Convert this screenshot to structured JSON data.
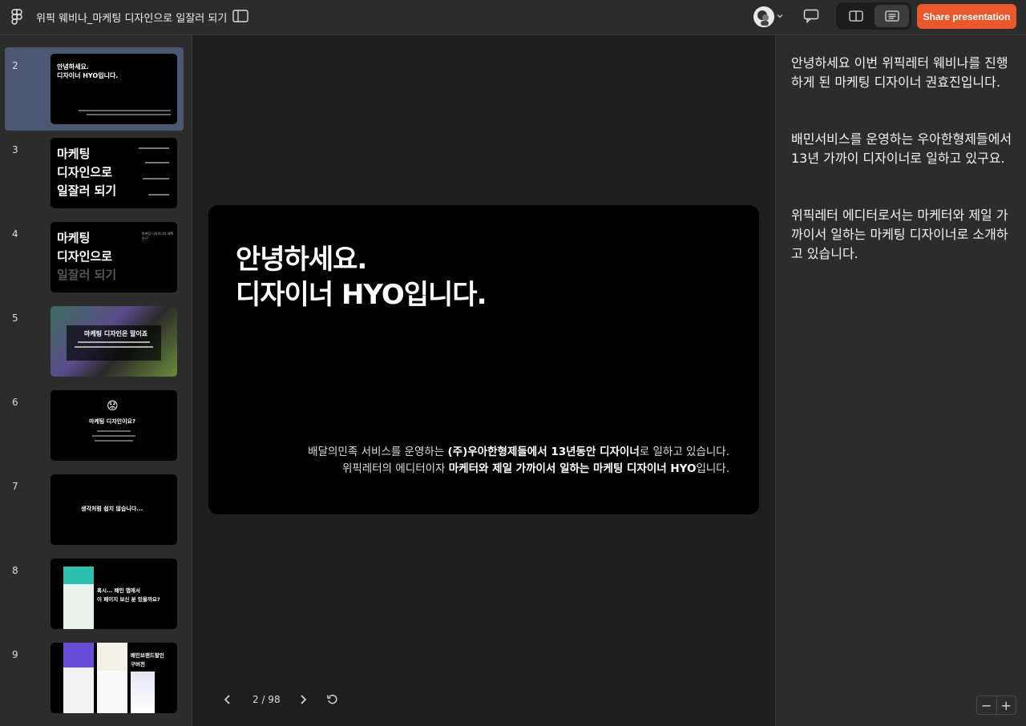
{
  "app": {
    "title": "위픽 웨비나_마케팅 디자인으로 일잘러 되기",
    "share_label": "Share presentation"
  },
  "sidebar": {
    "slides": [
      {
        "num": "2",
        "line1": "안녕하세요.",
        "line2": "디자이너 HYO입니다."
      },
      {
        "num": "3",
        "line1": "마케팅",
        "line2": "디자인으로",
        "line3": "일잘러 되기"
      },
      {
        "num": "4",
        "line1": "마케팅",
        "line2": "디자인으로",
        "line3": "일잘러 되기",
        "side": "마케팅 디자이너의 혜택은??"
      },
      {
        "num": "5",
        "line1": "마케팅 디자인은 말이죠"
      },
      {
        "num": "6",
        "line1": "마케팅 디자인이요?",
        "emoji": "😟"
      },
      {
        "num": "7",
        "line1": "생각처럼 쉽지 않습니다..."
      },
      {
        "num": "8",
        "line1": "혹시... 배민 앱에서",
        "line2": "이 페이지 보신 분 있을까요?"
      },
      {
        "num": "9",
        "line1": "배민브랜드할인",
        "line2": "구버전"
      }
    ]
  },
  "slide": {
    "heading_line1": "안녕하세요.",
    "heading_line2": "디자이너 HYO입니다.",
    "body_line1_pre": "배달의민족 서비스를 운영하는 ",
    "body_line1_bold": "(주)우아한형제들에서 13년동안 디자이너",
    "body_line1_post": "로 일하고 있습니다.",
    "body_line2_pre": "위픽레터의 에디터이자 ",
    "body_line2_bold": "마케터와 제일 가까이서 일하는 마케팅 디자이너 HYO",
    "body_line2_post": "입니다."
  },
  "nav": {
    "page_count": "2 / 98"
  },
  "notes": {
    "p1": "안녕하세요 이번 위픽레터 웨비나를 진행하게 된 마케팅 디자이너 권효진입니다.",
    "p2": "배민서비스를 운영하는 우아한형제들에서 13년 가까이 디자이너로 일하고 있구요.",
    "p3": "위픽레터 에디터로서는 마케터와 제일 가까이서 일하는 마케팅 디자이너로 소개하고 있습니다."
  },
  "zoom": {
    "minus": "−",
    "plus": "+"
  },
  "colors": {
    "accent": "#e8582b",
    "selected": "#4c5773"
  }
}
